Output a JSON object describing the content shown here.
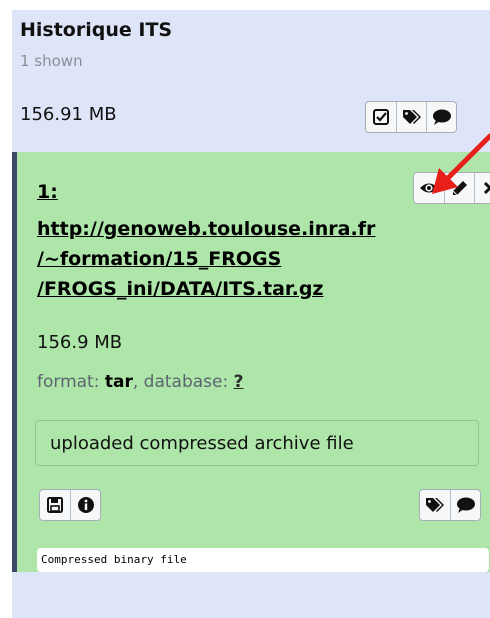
{
  "history": {
    "title": "Historique ITS",
    "shown": "1 shown",
    "size": "156.91 MB",
    "buttons": [
      {
        "icon": "checkbox-icon"
      },
      {
        "icon": "tags-icon"
      },
      {
        "icon": "comment-icon"
      }
    ]
  },
  "dataset": {
    "hid": "1:",
    "title_lines": [
      "http://genoweb.toulouse.inra.fr",
      "/~formation/15_FROGS",
      "/FROGS_ini/DATA/ITS.tar.gz"
    ],
    "top_buttons": [
      {
        "icon": "eye-icon"
      },
      {
        "icon": "pencil-icon"
      },
      {
        "icon": "delete-icon"
      }
    ],
    "size": "156.9 MB",
    "format_label": "format:",
    "format_value": "tar",
    "database_label": ", database:",
    "database_value": "?",
    "info": "uploaded compressed archive file",
    "bottom_left_buttons": [
      {
        "icon": "save-icon"
      },
      {
        "icon": "info-icon"
      }
    ],
    "bottom_right_buttons": [
      {
        "icon": "tags-icon"
      },
      {
        "icon": "comment-icon"
      }
    ],
    "peek": "Compressed binary file"
  },
  "colors": {
    "panel_bg": "#dfe5f9",
    "dataset_bg": "#aee6aa",
    "annotation_arrow": "#e8201a"
  }
}
